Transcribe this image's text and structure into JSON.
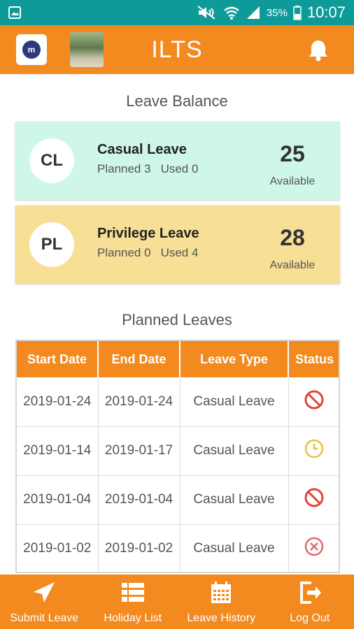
{
  "status_bar": {
    "battery": "35%",
    "time": "10:07"
  },
  "app_bar": {
    "title": "ILTS",
    "logo_text": "m",
    "icons": [
      "app-logo",
      "profile-avatar",
      "bell-icon"
    ]
  },
  "leave_balance": {
    "title": "Leave Balance",
    "cards": [
      {
        "badge": "CL",
        "name": "Casual Leave",
        "planned": "Planned 3",
        "used": "Used 0",
        "count": "25",
        "available": "Available",
        "color": "#cef7e7"
      },
      {
        "badge": "PL",
        "name": "Privilege Leave",
        "planned": "Planned 0",
        "used": "Used 4",
        "count": "28",
        "available": "Available",
        "color": "#f7df96"
      }
    ]
  },
  "planned_leaves": {
    "title": "Planned Leaves",
    "headers": [
      "Start Date",
      "End Date",
      "Leave Type",
      "Status"
    ],
    "rows": [
      {
        "start": "2019-01-24",
        "end": "2019-01-24",
        "type": "Casual Leave",
        "status_icon": "cancelled-icon"
      },
      {
        "start": "2019-01-14",
        "end": "2019-01-17",
        "type": "Casual Leave",
        "status_icon": "pending-clock-icon"
      },
      {
        "start": "2019-01-04",
        "end": "2019-01-04",
        "type": "Casual Leave",
        "status_icon": "cancelled-icon"
      },
      {
        "start": "2019-01-02",
        "end": "2019-01-02",
        "type": "Casual Leave",
        "status_icon": "rejected-icon"
      }
    ]
  },
  "bottom_nav": {
    "items": [
      {
        "label": "Submit Leave",
        "icon": "send-icon"
      },
      {
        "label": "Holiday List",
        "icon": "list-icon"
      },
      {
        "label": "Leave History",
        "icon": "calendar-icon"
      },
      {
        "label": "Log Out",
        "icon": "logout-icon"
      }
    ]
  },
  "colors": {
    "status_bar": "#0f9a9a",
    "primary": "#f28a1f",
    "cancelled": "#e0443a",
    "pending": "#e3c33a",
    "rejected": "#e06a6a"
  }
}
